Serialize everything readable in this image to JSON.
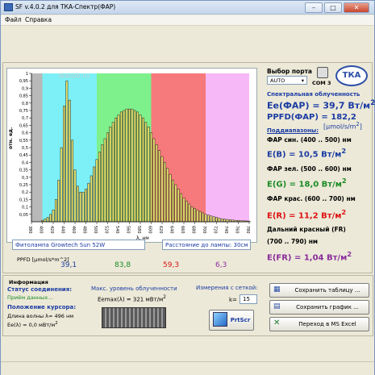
{
  "window": {
    "title": "SF v.4.0.2 для ТКА-Спектр(ФАР)",
    "min": "–",
    "max": "□",
    "close": "✕"
  },
  "menu": {
    "file": "Файл",
    "help": "Справка"
  },
  "watermark": "tkaspb.ru",
  "port": {
    "label": "Выбор порта",
    "value": "AUTO",
    "com": "COM 3"
  },
  "logo": "ТКА",
  "chart_data": {
    "type": "bar",
    "ylabel": "отн. ед.",
    "xlabel": "λ, нм",
    "xlim": [
      380,
      780
    ],
    "ylim": [
      0,
      1
    ],
    "x_ticks": [
      380,
      400,
      420,
      440,
      460,
      480,
      500,
      520,
      540,
      560,
      580,
      600,
      620,
      640,
      660,
      680,
      700,
      720,
      740,
      760,
      780
    ],
    "y_ticks": [
      "0,05",
      "0,1",
      "0,15",
      "0,2",
      "0,25",
      "0,3",
      "0,35",
      "0,4",
      "0,45",
      "0,5",
      "0,55",
      "0,6",
      "0,65",
      "0,7",
      "0,75",
      "0,8",
      "0,85",
      "0,9",
      "0,95",
      "1"
    ],
    "bands": [
      {
        "from": 380,
        "to": 400,
        "color": "#b8b8b8"
      },
      {
        "from": 400,
        "to": 500,
        "color": "#7df0f7"
      },
      {
        "from": 500,
        "to": 600,
        "color": "#7ef08c"
      },
      {
        "from": 600,
        "to": 700,
        "color": "#f6797b"
      },
      {
        "from": 700,
        "to": 780,
        "color": "#f7b8f7"
      }
    ],
    "x": [
      400,
      405,
      410,
      415,
      420,
      425,
      430,
      435,
      440,
      445,
      450,
      455,
      460,
      465,
      470,
      475,
      480,
      485,
      490,
      495,
      500,
      505,
      510,
      515,
      520,
      525,
      530,
      535,
      540,
      545,
      550,
      555,
      560,
      565,
      570,
      575,
      580,
      585,
      590,
      595,
      600,
      605,
      610,
      615,
      620,
      625,
      630,
      635,
      640,
      645,
      650,
      655,
      660,
      665,
      670,
      675,
      680,
      685,
      690,
      695,
      700,
      705,
      710,
      715,
      720,
      725,
      730,
      735,
      740,
      745,
      750,
      755,
      760,
      765,
      770,
      775,
      780
    ],
    "values": [
      0.01,
      0.02,
      0.03,
      0.05,
      0.08,
      0.15,
      0.28,
      0.5,
      0.78,
      0.95,
      0.82,
      0.55,
      0.35,
      0.24,
      0.2,
      0.2,
      0.22,
      0.26,
      0.31,
      0.37,
      0.42,
      0.47,
      0.52,
      0.56,
      0.6,
      0.64,
      0.67,
      0.7,
      0.72,
      0.74,
      0.75,
      0.76,
      0.76,
      0.76,
      0.75,
      0.74,
      0.72,
      0.7,
      0.67,
      0.64,
      0.6,
      0.56,
      0.52,
      0.48,
      0.44,
      0.4,
      0.36,
      0.32,
      0.28,
      0.25,
      0.22,
      0.19,
      0.16,
      0.14,
      0.12,
      0.1,
      0.09,
      0.08,
      0.07,
      0.06,
      0.05,
      0.045,
      0.04,
      0.035,
      0.03,
      0.025,
      0.02,
      0.018,
      0.016,
      0.014,
      0.012,
      0.01,
      0.009,
      0.008,
      0.007,
      0.006,
      0.005
    ]
  },
  "lamp": "Фитолампа Growtech Sun 52W",
  "distance": "Расстояние до лампы: 30см",
  "ppfd": {
    "label": "PPFD [μmol/s*m^2]",
    "blue": "39,1",
    "green": "83,8",
    "red": "59,3",
    "farred": "6,3"
  },
  "right": {
    "heading": "Спектральная облученность",
    "ee": "Ee(ФАР) = 39,7 Вт/м",
    "ppfd": "PPFD(ФАР) = 182,2",
    "ppfd_unit": "[μmol/s/m",
    "ranges": "Поддиапазоны:",
    "blue_label": "ФАР син. (400 .. 500) нм",
    "blue_val": "E(B) = 10,5 Вт/м",
    "green_label": "ФАР зел. (500 .. 600) нм",
    "green_val": "E(G) = 18,0 Вт/м",
    "red_label": "ФАР крас. (600 .. 700) нм",
    "red_val": "E(R) = 11,2 Вт/м",
    "fr_label": "Дальний красный (FR)",
    "fr_range": "(700 .. 790) нм",
    "fr_val": "E(FR) = 1,04 Вт/м",
    "sup2": "2"
  },
  "info": {
    "title": "Информация",
    "conn_label": "Статус соединения:",
    "conn_value": "Приём данных...",
    "max_label": "Макс. уровень облученности",
    "max_value": "Eemax(λ) = 321 мВт/м",
    "meas_label": "Измерения с сеткой:",
    "k_label": "k=",
    "k_value": "15",
    "cursor_label": "Положение курсора:",
    "cursor_wl": "Длина волны λ= 496 нм",
    "cursor_e": "Ee(λ) = 0,0 мВт/м",
    "prtscr": "PrtScr"
  },
  "buttons": {
    "save_table": "Сохранить таблицу ...",
    "save_graph": "Сохранить график ...",
    "excel": "Переход в MS Excel"
  }
}
